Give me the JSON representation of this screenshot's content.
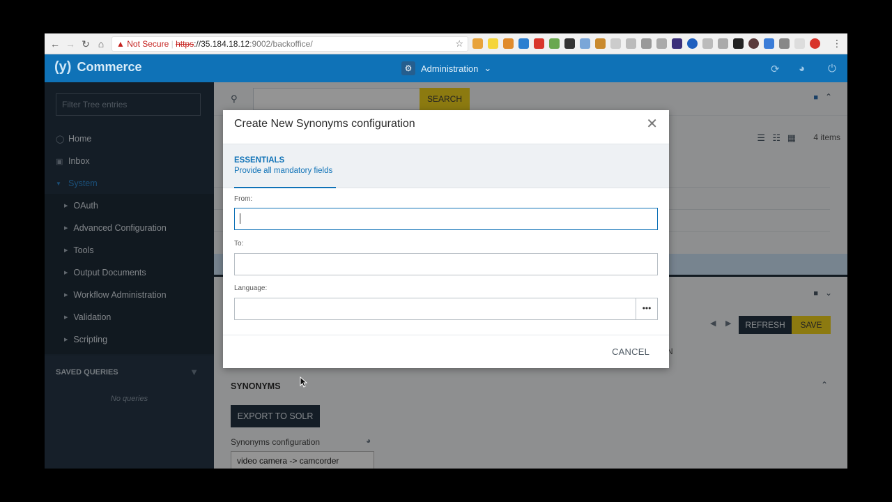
{
  "browser": {
    "url_warning": "Not Secure",
    "url_scheme": "https",
    "url_host": "://35.184.18.12",
    "url_path": ":9002/backoffice/"
  },
  "app": {
    "logo_mark": "(y)",
    "logo_text": "Commerce",
    "perspective": "Administration"
  },
  "sidebar": {
    "filter_placeholder": "Filter Tree entries",
    "nav": [
      {
        "label": "Home"
      },
      {
        "label": "Inbox"
      },
      {
        "label": "System"
      }
    ],
    "system_children": [
      {
        "label": "OAuth"
      },
      {
        "label": "Advanced Configuration"
      },
      {
        "label": "Tools"
      },
      {
        "label": "Output Documents"
      },
      {
        "label": "Workflow Administration"
      },
      {
        "label": "Validation"
      },
      {
        "label": "Scripting"
      }
    ],
    "saved_queries_title": "SAVED QUERIES",
    "no_queries": "No queries"
  },
  "main": {
    "search_label": "SEARCH",
    "item_count": "4 items",
    "refresh_label": "REFRESH",
    "save_label": "SAVE",
    "partial_tab": "N",
    "section_title": "SYNONYMS",
    "export_label": "EXPORT TO SOLR",
    "syn_config_label": "Synonyms configuration",
    "syn_config_value": "video camera -> camcorder"
  },
  "modal": {
    "title": "Create New Synonyms configuration",
    "step_name": "ESSENTIALS",
    "step_desc": "Provide all mandatory fields",
    "from_label": "From:",
    "from_value": "",
    "to_label": "To:",
    "to_value": "",
    "language_label": "Language:",
    "language_value": "",
    "language_btn": "•••",
    "cancel_label": "CANCEL"
  },
  "colors": {
    "header_blue": "#0f72b7",
    "sidebar_dark": "#243343",
    "accent_yellow": "#f2d21d"
  }
}
